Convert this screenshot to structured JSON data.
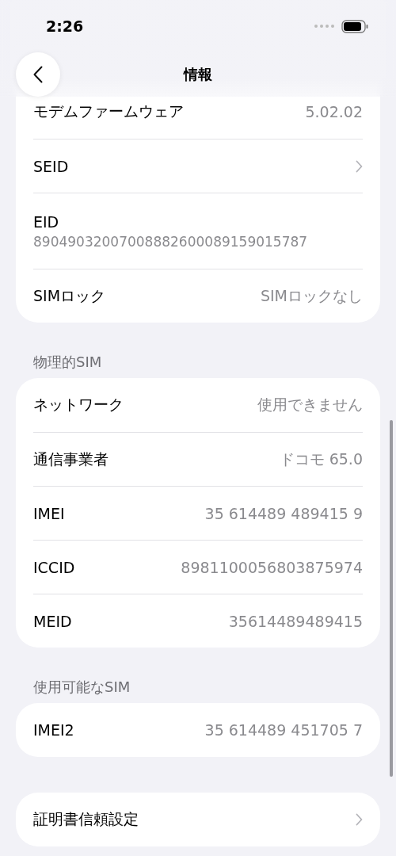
{
  "status_bar": {
    "time": "2:26"
  },
  "nav": {
    "title": "情報"
  },
  "sections": [
    {
      "rows": [
        {
          "kind": "value",
          "label": "モデムファームウェア",
          "value": "5.02.02"
        },
        {
          "kind": "link",
          "label": "SEID"
        },
        {
          "kind": "stacked",
          "label": "EID",
          "value": "89049032007008882600089159015787"
        },
        {
          "kind": "value",
          "label": "SIMロック",
          "value": "SIMロックなし"
        }
      ]
    },
    {
      "header": "物理的SIM",
      "rows": [
        {
          "kind": "value",
          "label": "ネットワーク",
          "value": "使用できません"
        },
        {
          "kind": "value",
          "label": "通信事業者",
          "value": "ドコモ 65.0"
        },
        {
          "kind": "value",
          "label": "IMEI",
          "value": "35 614489 489415 9"
        },
        {
          "kind": "value",
          "label": "ICCID",
          "value": "8981100056803875974"
        },
        {
          "kind": "value",
          "label": "MEID",
          "value": "35614489489415"
        }
      ]
    },
    {
      "header": "使用可能なSIM",
      "rows": [
        {
          "kind": "value",
          "label": "IMEI2",
          "value": "35 614489 451705 7"
        }
      ]
    },
    {
      "rows": [
        {
          "kind": "link",
          "label": "証明書信頼設定"
        }
      ]
    }
  ]
}
